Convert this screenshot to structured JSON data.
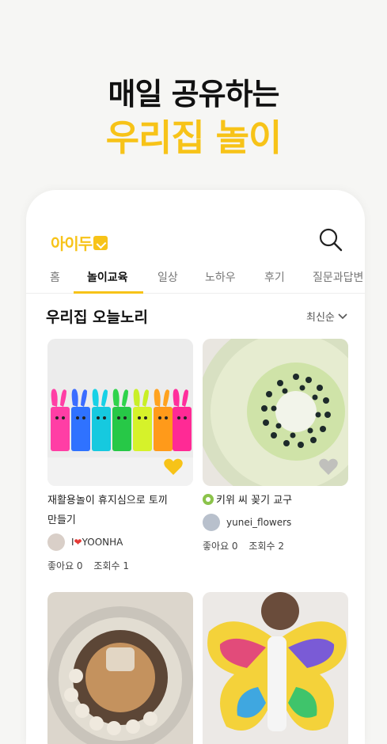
{
  "hero": {
    "line1": "매일 공유하는",
    "line2": "우리집 놀이"
  },
  "app": {
    "logo": "아이두",
    "tabs": [
      "홈",
      "놀이교육",
      "일상",
      "노하우",
      "후기",
      "질문과답변"
    ],
    "active_tab": "놀이교육"
  },
  "section": {
    "title": "우리집 오늘노리",
    "sort_label": "최신순"
  },
  "cards": [
    {
      "title_line1": "재활용놀이 휴지심으로 토끼",
      "title_line2": "만들기",
      "author_prefix": "I",
      "author_heart": "❤",
      "author_name": "YOONHA",
      "likes": "좋아요 0",
      "views": "조회수 1",
      "liked": true
    },
    {
      "title_line1": "키위 씨 꽂기 교구",
      "title_line2": "",
      "author_prefix": "",
      "author_heart": "",
      "author_name": "yunei_flowers",
      "likes": "좋아요 0",
      "views": "조회수 2",
      "liked": false
    }
  ],
  "colors": {
    "accent": "#f7c318",
    "background": "#f6f6f4"
  }
}
